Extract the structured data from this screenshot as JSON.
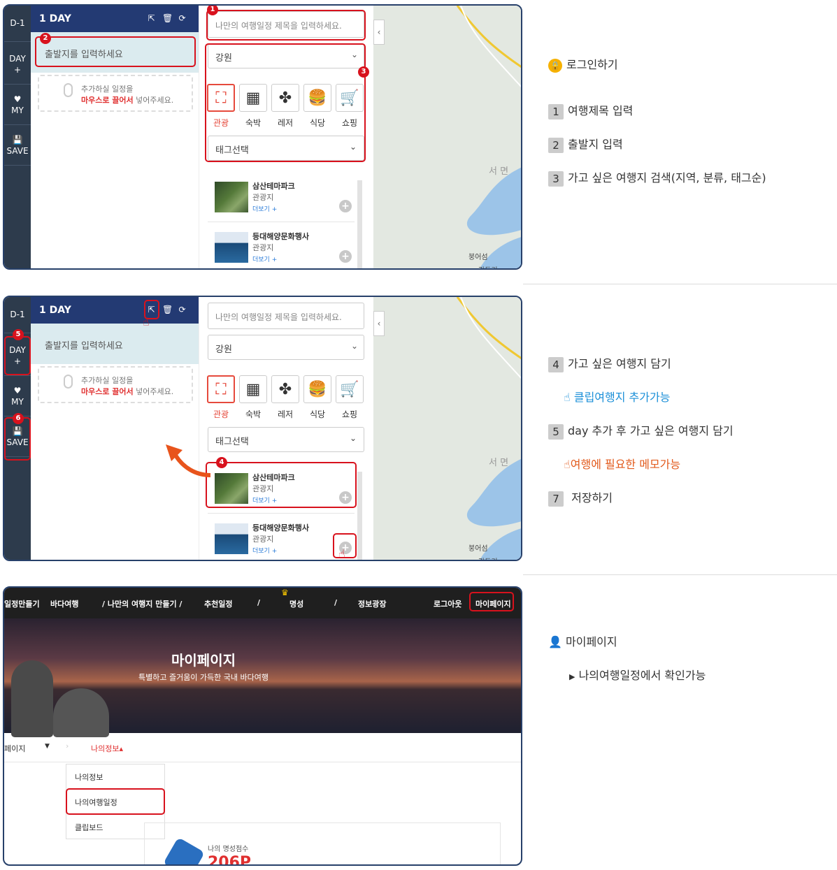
{
  "planner": {
    "day_badge": "D-1",
    "day_title": "1 DAY",
    "sidebar": {
      "day_add": "DAY",
      "day_add_plus": "+",
      "my": "MY",
      "save": "SAVE"
    },
    "start_placeholder": "출발지를 입력하세요",
    "drag_hint_line1": "추가하실 일정을",
    "drag_hint_emph": "마우스로 끌어서",
    "drag_hint_rest": " 넣어주세요.",
    "title_placeholder": "나만의 여행일정 제목을 입력하세요.",
    "region": "강원",
    "categories": [
      "관광",
      "숙박",
      "레저",
      "식당",
      "쇼핑"
    ],
    "tag_select": "태그선택",
    "places": [
      {
        "name": "삼산테마파크",
        "type": "관광지",
        "more": "더보기 +"
      },
      {
        "name": "등대해양문화행사",
        "type": "관광지",
        "more": "더보기 +"
      }
    ],
    "map_labels": {
      "area": "서  면",
      "village": "붕어섬",
      "village2": "강동리"
    }
  },
  "annotations": {
    "login": "로그인하기",
    "step1": {
      "num": "1",
      "text": "여행제목 입력"
    },
    "step2": {
      "num": "2",
      "text": "출발지 입력"
    },
    "step3": {
      "num": "3",
      "text": "가고 싶은 여행지 검색(지역, 분류, 태그순)"
    },
    "step4": {
      "num": "4",
      "text": "가고 싶은 여행지 담기"
    },
    "step4_note": "클립여행지 추가가능",
    "step5": {
      "num": "5",
      "text": "day 추가 후 가고 싶은 여행지 담기"
    },
    "step5_note": "여행에 필요한 메모가능",
    "step7": {
      "num": "7",
      "text": "저장하기"
    },
    "mypage": "마이페이지",
    "mypage_note": "나의여행일정에서 확인가능"
  },
  "mypage_screen": {
    "nav": [
      "일정만들기",
      "바다여행",
      "/ 나만의 여행지 만들기 /",
      "추천일정",
      "/",
      "명성",
      "/",
      "정보광장"
    ],
    "logout": "로그아웃",
    "mypage_btn": "마이페이지",
    "hero_title": "마이페이지",
    "hero_sub": "특별하고 즐거움이 가득한 국내 바다여행",
    "crumb_first": "페이지",
    "crumb_current": "나의정보▴",
    "menu": [
      "나의정보",
      "나의여행일정",
      "클립보드"
    ],
    "score_label": "나의 명성점수",
    "score_value": "206P"
  },
  "colors": {
    "navy": "#233a73",
    "sidebar": "#2d3b4c",
    "red": "#d8121d",
    "accent": "#e64a3c"
  }
}
